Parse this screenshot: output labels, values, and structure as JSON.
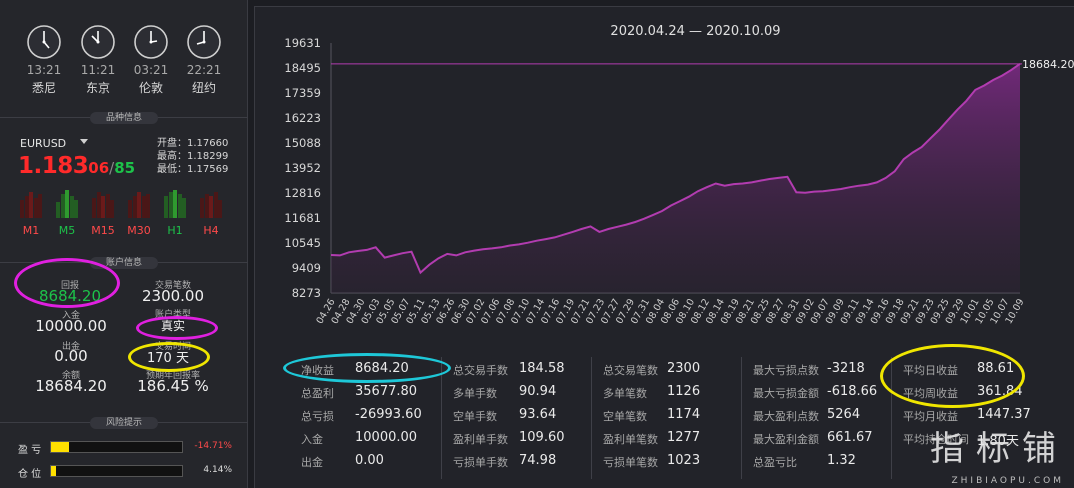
{
  "clocks": [
    {
      "time": "13:21",
      "city": "悉尼"
    },
    {
      "time": "11:21",
      "city": "东京"
    },
    {
      "time": "03:21",
      "city": "伦敦"
    },
    {
      "time": "22:21",
      "city": "纽约"
    }
  ],
  "sections": {
    "symbol_info": "品种信息",
    "account_info": "账户信息",
    "risk": "风险提示"
  },
  "symbol": {
    "name": "EURUSD",
    "price_big": "1.183",
    "price_pip": "06",
    "slash": "/",
    "price_pip2": "85",
    "open": "开盘：1.17660",
    "high": "最高：1.18299",
    "low": "最低：1.17569"
  },
  "timeframes": [
    "M1",
    "M5",
    "M15",
    "M30",
    "H1",
    "H4"
  ],
  "account": {
    "return_label": "回报",
    "return_value": "8684.20",
    "trades_label": "交易笔数",
    "trades_value": "2300.00",
    "type_label": "账户类型",
    "type_value": "真实",
    "deposit_label": "入金",
    "deposit_value": "10000.00",
    "withdraw_label": "出金",
    "withdraw_value": "0.00",
    "days_label": "交易时间",
    "days_value": "170 天",
    "balance_label": "余额",
    "balance_value": "18684.20",
    "annual_label": "预期年回报率",
    "annual_value": "186.45 %"
  },
  "risk": {
    "profit_label": "盈  亏",
    "profit_value": "-14.71%",
    "profit_fraction": 0.14,
    "position_label": "仓  位",
    "position_value": "4.14%",
    "position_fraction": 0.04
  },
  "chart_data": {
    "type": "area",
    "title": "2020.04.24 — 2020.10.09",
    "last_value_label": "18684.20",
    "ylim": [
      8273,
      19631
    ],
    "yticks": [
      19631,
      18495,
      17359,
      16223,
      15088,
      13952,
      12816,
      11681,
      10545,
      9409,
      8273
    ],
    "xticks": [
      "04.26",
      "04.28",
      "04.30",
      "05.03",
      "05.05",
      "05.07",
      "05.11",
      "05.13",
      "06.26",
      "06.30",
      "07.02",
      "07.06",
      "07.08",
      "07.10",
      "07.14",
      "07.16",
      "07.19",
      "07.21",
      "07.23",
      "07.27",
      "07.29",
      "07.31",
      "08.04",
      "08.06",
      "08.10",
      "08.12",
      "08.14",
      "08.19",
      "08.21",
      "08.25",
      "08.27",
      "08.31",
      "09.02",
      "09.07",
      "09.09",
      "09.11",
      "09.14",
      "09.16",
      "09.18",
      "09.21",
      "09.23",
      "09.25",
      "09.29",
      "10.01",
      "10.05",
      "10.07",
      "10.09"
    ],
    "values": [
      10000,
      9980,
      10120,
      10180,
      10230,
      10350,
      9880,
      9980,
      10080,
      10150,
      9200,
      9560,
      9850,
      10050,
      9980,
      10120,
      10200,
      10260,
      10300,
      10350,
      10430,
      10480,
      10560,
      10650,
      10720,
      10800,
      10920,
      11050,
      11180,
      11300,
      11050,
      11180,
      11280,
      11380,
      11500,
      11650,
      11820,
      12000,
      12250,
      12450,
      12650,
      12900,
      13080,
      13250,
      13150,
      13220,
      13250,
      13300,
      13380,
      13450,
      13500,
      13550,
      12850,
      12830,
      12880,
      12900,
      12950,
      13000,
      13080,
      13150,
      13200,
      13300,
      13500,
      13800,
      14350,
      14650,
      14900,
      15300,
      15700,
      16150,
      16600,
      17000,
      17500,
      17700,
      17950,
      18150,
      18400,
      18684.2
    ],
    "color": "#b23cb0"
  },
  "stats": {
    "col1": [
      {
        "label": "净收益",
        "value": "8684.20"
      },
      {
        "label": "总盈利",
        "value": "35677.80"
      },
      {
        "label": "总亏损",
        "value": "-26993.60"
      },
      {
        "label": "入金",
        "value": "10000.00"
      },
      {
        "label": "出金",
        "value": "0.00"
      }
    ],
    "col2": [
      {
        "label": "总交易手数",
        "value": "184.58"
      },
      {
        "label": "多单手数",
        "value": "90.94"
      },
      {
        "label": "空单手数",
        "value": "93.64"
      },
      {
        "label": "盈利单手数",
        "value": "109.60"
      },
      {
        "label": "亏损单手数",
        "value": "74.98"
      }
    ],
    "col3": [
      {
        "label": "总交易笔数",
        "value": "2300"
      },
      {
        "label": "多单笔数",
        "value": "1126"
      },
      {
        "label": "空单笔数",
        "value": "1174"
      },
      {
        "label": "盈利单笔数",
        "value": "1277"
      },
      {
        "label": "亏损单笔数",
        "value": "1023"
      }
    ],
    "col4": [
      {
        "label": "最大亏损点数",
        "value": "-3218"
      },
      {
        "label": "最大亏损金额",
        "value": "-618.66"
      },
      {
        "label": "最大盈利点数",
        "value": "5264"
      },
      {
        "label": "最大盈利金额",
        "value": "661.67"
      },
      {
        "label": "总盈亏比",
        "value": "1.32"
      }
    ],
    "col5": [
      {
        "label": "平均日收益",
        "value": "88.61"
      },
      {
        "label": "平均周收益",
        "value": "361.84"
      },
      {
        "label": "平均月收益",
        "value": "1447.37"
      },
      {
        "label": "平均持仓时间",
        "value": "1.80天"
      }
    ]
  },
  "watermark": {
    "text": "指标铺",
    "sub": "ZHIBIAOPU.COM"
  },
  "colors": {
    "up": "#1dc24a",
    "down": "#ff2a2a",
    "accent": "#b23cb0",
    "highlight_cyan": "#1ec8d8",
    "highlight_yellow": "#f0e600",
    "highlight_magenta": "#e020e0"
  }
}
